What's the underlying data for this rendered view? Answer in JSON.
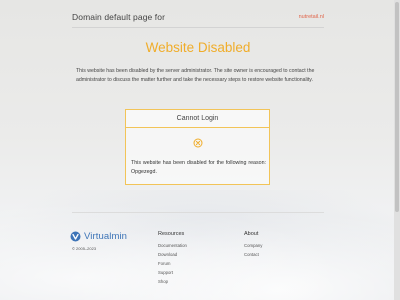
{
  "header": {
    "title": "Domain default page for",
    "domain": "nutretail.nl"
  },
  "main": {
    "headline": "Website Disabled",
    "message": "This website has been disabled by the server administrator. The site owner is encouraged to contact the administrator to discuss the matter further and take the necessary steps to restore website functionality."
  },
  "card": {
    "title": "Cannot Login",
    "icon": "x-circle-icon",
    "text": "This website has been disabled for the following reason: Opgezegd."
  },
  "footer": {
    "brand": "Virtualmin",
    "brand_icon": "virtualmin-logo-icon",
    "copyright": "© 2005–2023",
    "resources": {
      "title": "Resources",
      "links": [
        "Documentation",
        "Download",
        "Forum",
        "Support",
        "Shop"
      ]
    },
    "about": {
      "title": "About",
      "links": [
        "Company",
        "Contact"
      ]
    }
  },
  "colors": {
    "accent": "#f0ad2a",
    "domain": "#e0664c",
    "brand": "#3d74b7"
  }
}
